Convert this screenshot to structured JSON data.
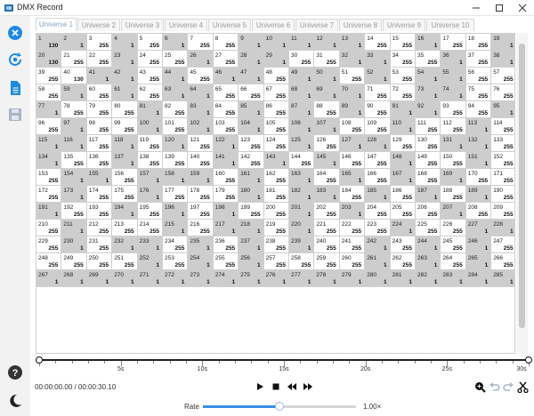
{
  "window": {
    "title": "DMX Record"
  },
  "tabs": [
    "Universe 1",
    "Universe 2",
    "Universe 3",
    "Universe 4",
    "Universe 5",
    "Universe 6",
    "Universe 7",
    "Universe 8",
    "Universe 9",
    "Universe 10"
  ],
  "active_tab": 0,
  "grid": {
    "columns": 19,
    "first_channel": 1,
    "last_channel": 285,
    "on_value": "255",
    "off_value": "1",
    "special_values": {
      "1": "130",
      "20": "130",
      "40": "130"
    },
    "on_channels": [
      3,
      5,
      7,
      8,
      14,
      15,
      17,
      18,
      21,
      22,
      24,
      25,
      27,
      30,
      31,
      34,
      35,
      37,
      39,
      40,
      43,
      45,
      48,
      51,
      53,
      56,
      57,
      58,
      60,
      62,
      65,
      66,
      67,
      71,
      72,
      75,
      76,
      78,
      79,
      80,
      82,
      84,
      86,
      88,
      90,
      93,
      94,
      96,
      98,
      99,
      101,
      103,
      105,
      108,
      109,
      111,
      112,
      114,
      117,
      119,
      121,
      123,
      124,
      126,
      129,
      130,
      133,
      135,
      136,
      138,
      139,
      140,
      142,
      144,
      146,
      147,
      149,
      150,
      152,
      153,
      156,
      160,
      162,
      164,
      166,
      168,
      170,
      171,
      172,
      174,
      175,
      177,
      178,
      179,
      181,
      184,
      186,
      188,
      190,
      192,
      193,
      195,
      197,
      199,
      200,
      202,
      204,
      205,
      206,
      208,
      209,
      210,
      212,
      213,
      214,
      216,
      219,
      221,
      222,
      223,
      225,
      226,
      229,
      231,
      234,
      236,
      238,
      240,
      241,
      243,
      245,
      247,
      248,
      249,
      250,
      251,
      253,
      255,
      257,
      258,
      259,
      260,
      262,
      264,
      266
    ]
  },
  "timeline": {
    "tick_labels": [
      "5s",
      "10s",
      "15s",
      "20s",
      "25s",
      "30s"
    ],
    "duration_s": 30.1,
    "position_s": 0,
    "timecode": "00:00:00.00 / 00:00:30.10"
  },
  "controls": {
    "play": "play-icon",
    "stop": "stop-icon",
    "rewind": "rewind-icon",
    "forward": "fast-forward-icon",
    "zoom": "zoom-icon",
    "undo": "undo-icon",
    "redo": "redo-icon",
    "cut": "scissors-icon"
  },
  "rate": {
    "label": "Rate",
    "value_text": "1.00×",
    "fraction": 0.5
  },
  "colors": {
    "accent": "#1e88e5",
    "cell_on": "#ffffff",
    "cell_off": "#cdcdcd"
  }
}
